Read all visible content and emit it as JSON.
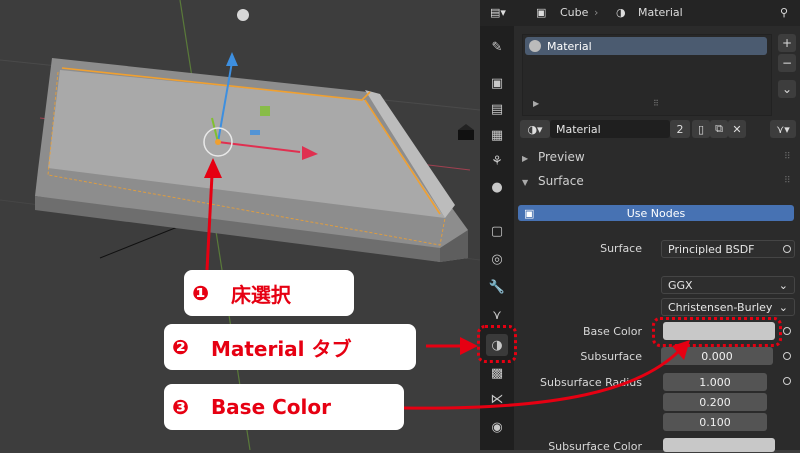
{
  "header": {
    "object_name": "Cube",
    "context_name": "Material"
  },
  "material_slots": [
    {
      "label": "Material"
    }
  ],
  "material_selector": {
    "name": "Material",
    "users": "2"
  },
  "sections": {
    "preview": "Preview",
    "surface": "Surface"
  },
  "use_nodes_label": "Use Nodes",
  "surface_settings": {
    "surface_label": "Surface",
    "surface_value": "Principled BSDF",
    "distribution": "GGX",
    "subsurface_method": "Christensen-Burley",
    "base_color_label": "Base Color",
    "base_color_value": "#c8c8c8",
    "subsurface_label": "Subsurface",
    "subsurface_value": "0.000",
    "subsurface_radius_label": "Subsurface Radius",
    "subsurface_radius_values": [
      "1.000",
      "0.200",
      "0.100"
    ],
    "subsurface_color_label": "Subsurface Color"
  },
  "annotations": [
    {
      "num": "❶",
      "text": "床選択"
    },
    {
      "num": "❷",
      "text": "Material タブ"
    },
    {
      "num": "❸",
      "text": "Base Color"
    }
  ],
  "colors": {
    "accent_blue": "#4772b3",
    "annotation_red": "#e60012",
    "selection_orange": "#f0a030"
  }
}
